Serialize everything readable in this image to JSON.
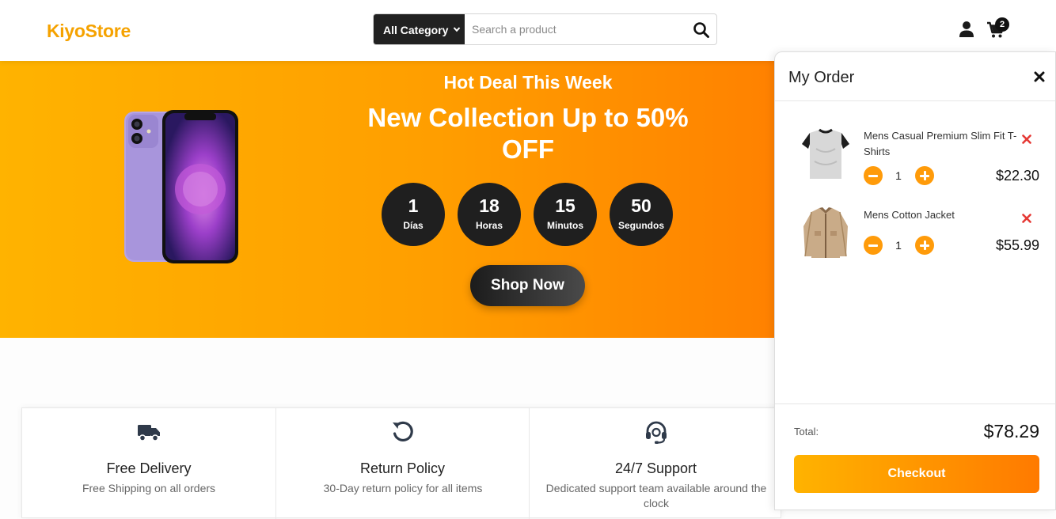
{
  "brand": {
    "name": "KiyoStore",
    "color": "#f5a200"
  },
  "search": {
    "category": "All Category",
    "placeholder": "Search a product"
  },
  "header": {
    "cart_count": "2"
  },
  "hero": {
    "subtitle": "Hot Deal This Week",
    "title": "New Collection Up to 50% OFF",
    "countdown": [
      {
        "value": "1",
        "label": "Días"
      },
      {
        "value": "18",
        "label": "Horas"
      },
      {
        "value": "15",
        "label": "Minutos"
      },
      {
        "value": "50",
        "label": "Segundos"
      }
    ],
    "cta": "Shop Now"
  },
  "features": [
    {
      "icon": "truck-icon",
      "title": "Free Delivery",
      "desc": "Free Shipping on all orders"
    },
    {
      "icon": "return-icon",
      "title": "Return Policy",
      "desc": "30-Day return policy for all items"
    },
    {
      "icon": "headset-icon",
      "title": "24/7 Support",
      "desc": "Dedicated support team available around the clock"
    }
  ],
  "order": {
    "title": "My Order",
    "items": [
      {
        "name": "Mens Casual Premium Slim Fit T-Shirts",
        "qty": "1",
        "price": "$22.30"
      },
      {
        "name": "Mens Cotton Jacket",
        "qty": "1",
        "price": "$55.99"
      }
    ],
    "total_label": "Total:",
    "total": "$78.29",
    "checkout": "Checkout"
  }
}
